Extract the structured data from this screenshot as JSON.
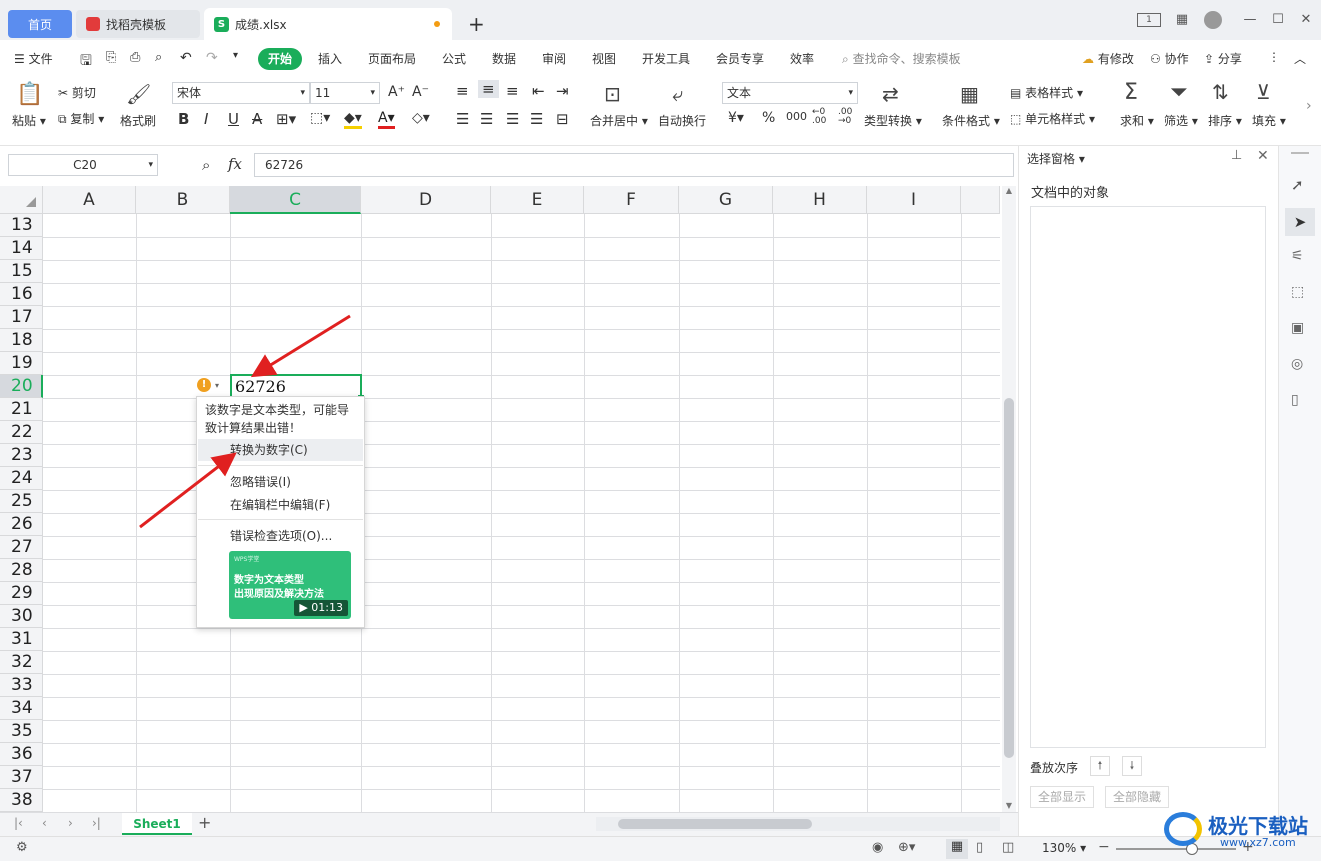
{
  "tabs": {
    "home": "首页",
    "docer": "找稻壳模板",
    "file": "成绩.xlsx",
    "new_tab": "+"
  },
  "menubar": {
    "file_menu": "文件",
    "start": "开始",
    "items": [
      "插入",
      "页面布局",
      "公式",
      "数据",
      "审阅",
      "视图",
      "开发工具",
      "会员专享",
      "效率"
    ],
    "search_placeholder": "查找命令、搜索模板",
    "modified": "有修改",
    "collab": "协作",
    "share": "分享"
  },
  "ribbon": {
    "paste": "粘贴",
    "cut": "剪切",
    "copy": "复制",
    "format_painter": "格式刷",
    "font_name": "宋体",
    "font_size": "11",
    "merge_center": "合并居中",
    "wrap_text": "自动换行",
    "number_format": "文本",
    "type_convert": "类型转换",
    "cond_format": "条件格式",
    "table_style": "表格样式",
    "cell_style": "单元格样式",
    "sum": "求和",
    "filter": "筛选",
    "sort": "排序",
    "fill": "填充"
  },
  "formula_bar": {
    "name_box": "C20",
    "fx": "fx",
    "value": "62726"
  },
  "grid": {
    "columns": [
      "A",
      "B",
      "C",
      "D",
      "E",
      "F",
      "G",
      "H",
      "I"
    ],
    "rows": [
      "13",
      "14",
      "15",
      "16",
      "17",
      "18",
      "19",
      "20",
      "21",
      "22",
      "23",
      "24",
      "25",
      "26",
      "27",
      "28",
      "29",
      "30",
      "31",
      "32",
      "33",
      "34",
      "35",
      "36",
      "37",
      "38"
    ],
    "active_cell_value": "62726"
  },
  "popup": {
    "message": "该数字是文本类型，可能导致计算结果出错！",
    "convert": "转换为数字(C)",
    "ignore": "忽略错误(I)",
    "edit_in_bar": "在编辑栏中编辑(F)",
    "options": "错误检查选项(O)...",
    "video_brand": "WPS学堂",
    "video_title_1": "数字为文本类型",
    "video_title_2": "出现原因及解决方法",
    "video_duration": "01:13"
  },
  "pane": {
    "title": "选择窗格",
    "objects_label": "文档中的对象",
    "order_label": "叠放次序",
    "show_all": "全部显示",
    "hide_all": "全部隐藏"
  },
  "sheetbar": {
    "sheet1": "Sheet1",
    "add": "+"
  },
  "status": {
    "zoom": "130%"
  },
  "watermark": {
    "name": "极光下载站",
    "url": "www.xz7.com"
  },
  "colors": {
    "accent_green": "#1aad5a",
    "home_tab_blue": "#5b8def",
    "arrow_red": "#e02020"
  }
}
